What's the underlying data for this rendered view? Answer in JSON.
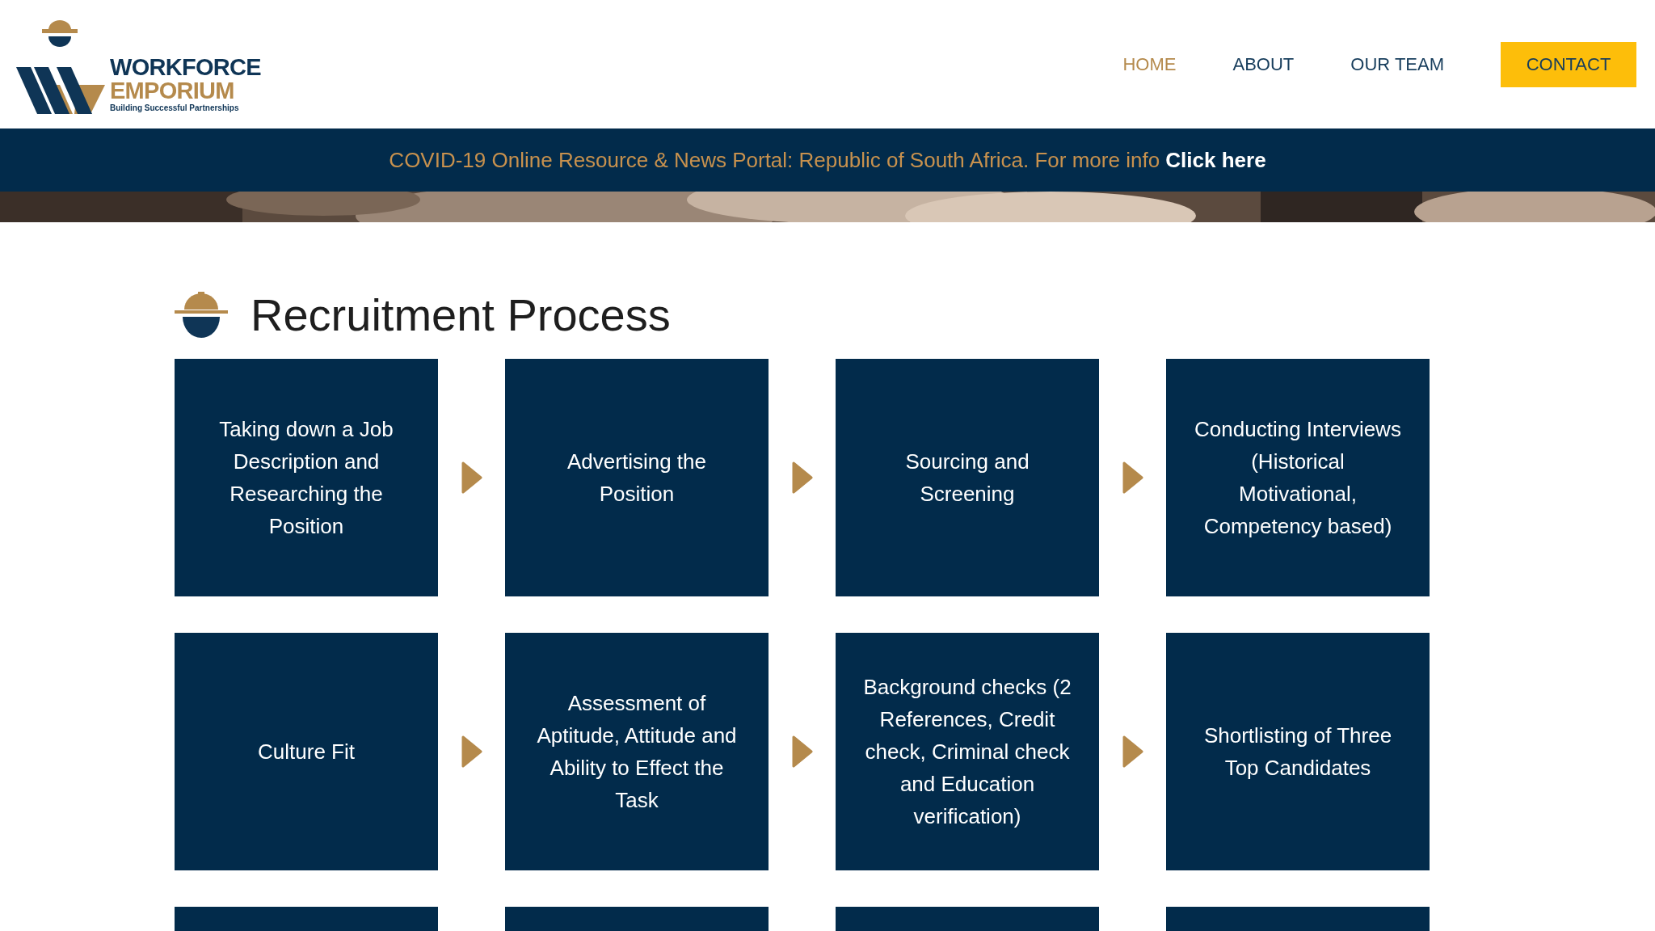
{
  "logo": {
    "name_top": "WORKFORCE",
    "name_bottom": "EMPORIUM",
    "tagline": "Building Successful Partnerships"
  },
  "nav": [
    {
      "label": "HOME",
      "selected": true,
      "kind": "link"
    },
    {
      "label": "ABOUT",
      "selected": false,
      "kind": "link"
    },
    {
      "label": "OUR TEAM",
      "selected": false,
      "kind": "link"
    },
    {
      "label": "CONTACT",
      "selected": false,
      "kind": "button"
    }
  ],
  "banner": {
    "text": "COVID-19 Online Resource & News Portal: Republic of South Africa. For more info",
    "link": "Click here"
  },
  "section": {
    "title": "Recruitment Process"
  },
  "steps": [
    {
      "kind": "step",
      "label": "Taking down a Job Description and Researching the Position"
    },
    {
      "kind": "step",
      "label": "Advertising the Position"
    },
    {
      "kind": "step",
      "label": "Sourcing and Screening"
    },
    {
      "kind": "step",
      "label": "Conducting Interviews (Historical Motivational, Competency based)"
    },
    {
      "kind": "step",
      "label": "Culture Fit"
    },
    {
      "kind": "step",
      "label": "Assessment of Aptitude, Attitude and Ability to Effect the Task"
    },
    {
      "kind": "step",
      "label": "Background checks (2 References, Credit check, Criminal check and Education verification)"
    },
    {
      "kind": "step",
      "label": "Shortlisting of Three Top Candidates"
    },
    {
      "kind": "cut"
    },
    {
      "kind": "cut"
    },
    {
      "kind": "cut"
    },
    {
      "kind": "cut"
    }
  ]
}
